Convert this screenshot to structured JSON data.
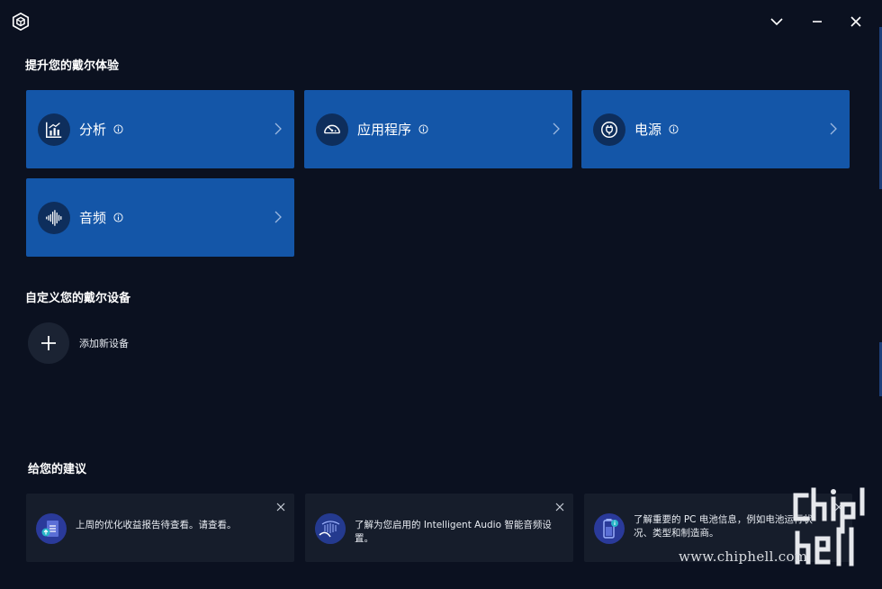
{
  "window": {
    "controls": {
      "collapse_icon": "chevron-down-icon",
      "minimize_icon": "minimize-icon",
      "close_icon": "close-icon"
    }
  },
  "experience": {
    "title": "提升您的戴尔体验",
    "tiles": [
      {
        "label": "分析",
        "icon": "analytics-chart-icon"
      },
      {
        "label": "应用程序",
        "icon": "speedometer-icon"
      },
      {
        "label": "电源",
        "icon": "power-plug-icon"
      },
      {
        "label": "音频",
        "icon": "audio-waveform-icon"
      }
    ]
  },
  "devices": {
    "title": "自定义您的戴尔设备",
    "add_label": "添加新设备"
  },
  "suggestions": {
    "title": "给您的建议",
    "cards": [
      {
        "text": "上周的优化收益报告待查看。请查看。",
        "icon": "report-upload-icon"
      },
      {
        "text": "了解为您启用的 Intelligent Audio 智能音频设置。",
        "icon": "audio-settings-icon"
      },
      {
        "text": "了解重要的 PC 电池信息，例如电池运行状况、类型和制造商。",
        "icon": "battery-info-icon"
      }
    ]
  },
  "watermark": {
    "text": "www.chiphell.com"
  },
  "colors": {
    "background": "#0b1120",
    "tile": "#1456a8",
    "card": "#161d2b"
  }
}
